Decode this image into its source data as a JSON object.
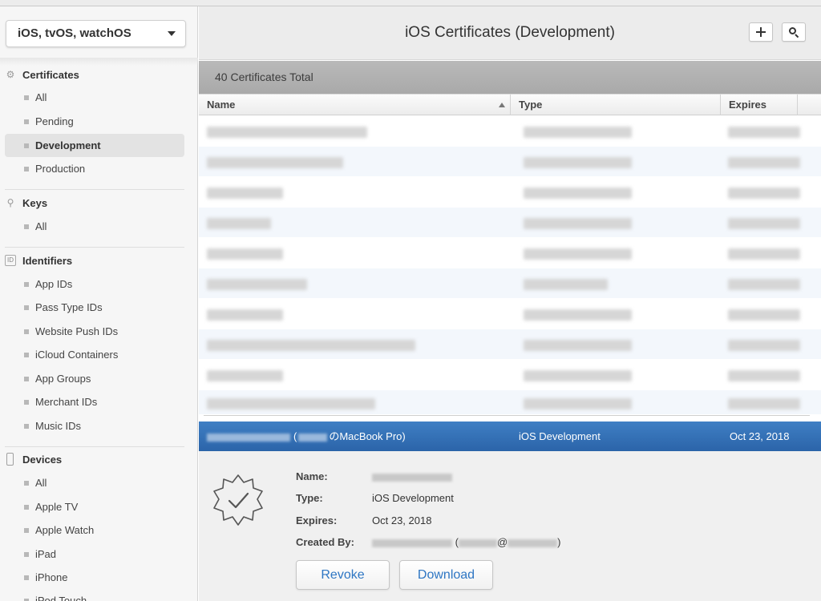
{
  "platform": {
    "selected": "iOS, tvOS, watchOS"
  },
  "sidebar": {
    "sections": [
      {
        "title": "Certificates",
        "icon": "gear-icon",
        "items": [
          "All",
          "Pending",
          "Development",
          "Production"
        ],
        "selected": "Development"
      },
      {
        "title": "Keys",
        "icon": "key-icon",
        "items": [
          "All"
        ]
      },
      {
        "title": "Identifiers",
        "icon": "id-icon",
        "icon_text": "ID",
        "items": [
          "App IDs",
          "Pass Type IDs",
          "Website Push IDs",
          "iCloud Containers",
          "App Groups",
          "Merchant IDs",
          "Music IDs"
        ]
      },
      {
        "title": "Devices",
        "icon": "phone-icon",
        "items": [
          "All",
          "Apple TV",
          "Apple Watch",
          "iPad",
          "iPhone",
          "iPod Touch"
        ]
      }
    ]
  },
  "header": {
    "title": "iOS Certificates (Development)"
  },
  "summary": {
    "total": "40 Certificates Total"
  },
  "table": {
    "columns": [
      "Name",
      "Type",
      "Expires"
    ],
    "selected_row": {
      "name_paren_open": "(",
      "name_suffix": "のMacBook Pro)",
      "type": "iOS Development",
      "expires": "Oct 23, 2018"
    }
  },
  "detail": {
    "labels": {
      "name": "Name:",
      "type": "Type:",
      "expires": "Expires:",
      "created_by": "Created By:"
    },
    "type": "iOS Development",
    "expires": "Oct 23, 2018",
    "created_paren_open": "(",
    "created_at": "@",
    "created_paren_close": ")"
  },
  "buttons": {
    "revoke": "Revoke",
    "download": "Download"
  },
  "colors": {
    "selection": "#2f6bb0",
    "link_blue": "#2e76c3"
  }
}
